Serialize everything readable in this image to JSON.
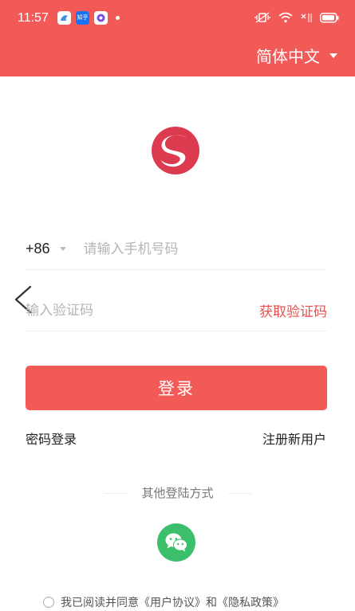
{
  "status_bar": {
    "time": "11:57",
    "app1_icon": "bird-icon",
    "app2_label": "知乎",
    "app3_icon": "chat-icon"
  },
  "header": {
    "language_label": "简体中文"
  },
  "form": {
    "country_code": "+86",
    "phone_placeholder": "请输入手机号码",
    "code_placeholder": "输入验证码",
    "get_code_label": "获取验证码",
    "login_label": "登录"
  },
  "links": {
    "password_login": "密码登录",
    "register": "注册新用户"
  },
  "other_login_label": "其他登陆方式",
  "agreement": {
    "prefix": "我已阅读并同意",
    "user_agreement": "《用户协议》",
    "and": "和",
    "privacy_policy": "《隐私政策》"
  },
  "colors": {
    "brand": "#f25a58",
    "link_red": "#e6514f",
    "wechat_green": "#3cbf6b"
  }
}
